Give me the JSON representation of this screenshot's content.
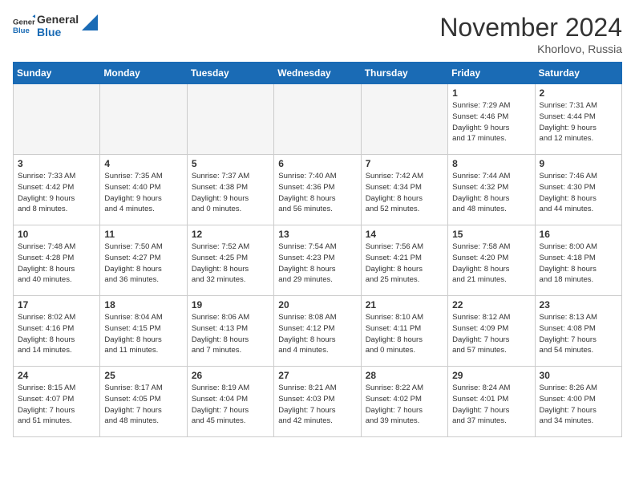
{
  "header": {
    "logo_line1": "General",
    "logo_line2": "Blue",
    "month": "November 2024",
    "location": "Khorlovo, Russia"
  },
  "weekdays": [
    "Sunday",
    "Monday",
    "Tuesday",
    "Wednesday",
    "Thursday",
    "Friday",
    "Saturday"
  ],
  "weeks": [
    [
      {
        "day": "",
        "info": "",
        "empty": true
      },
      {
        "day": "",
        "info": "",
        "empty": true
      },
      {
        "day": "",
        "info": "",
        "empty": true
      },
      {
        "day": "",
        "info": "",
        "empty": true
      },
      {
        "day": "",
        "info": "",
        "empty": true
      },
      {
        "day": "1",
        "info": "Sunrise: 7:29 AM\nSunset: 4:46 PM\nDaylight: 9 hours\nand 17 minutes."
      },
      {
        "day": "2",
        "info": "Sunrise: 7:31 AM\nSunset: 4:44 PM\nDaylight: 9 hours\nand 12 minutes."
      }
    ],
    [
      {
        "day": "3",
        "info": "Sunrise: 7:33 AM\nSunset: 4:42 PM\nDaylight: 9 hours\nand 8 minutes."
      },
      {
        "day": "4",
        "info": "Sunrise: 7:35 AM\nSunset: 4:40 PM\nDaylight: 9 hours\nand 4 minutes."
      },
      {
        "day": "5",
        "info": "Sunrise: 7:37 AM\nSunset: 4:38 PM\nDaylight: 9 hours\nand 0 minutes."
      },
      {
        "day": "6",
        "info": "Sunrise: 7:40 AM\nSunset: 4:36 PM\nDaylight: 8 hours\nand 56 minutes."
      },
      {
        "day": "7",
        "info": "Sunrise: 7:42 AM\nSunset: 4:34 PM\nDaylight: 8 hours\nand 52 minutes."
      },
      {
        "day": "8",
        "info": "Sunrise: 7:44 AM\nSunset: 4:32 PM\nDaylight: 8 hours\nand 48 minutes."
      },
      {
        "day": "9",
        "info": "Sunrise: 7:46 AM\nSunset: 4:30 PM\nDaylight: 8 hours\nand 44 minutes."
      }
    ],
    [
      {
        "day": "10",
        "info": "Sunrise: 7:48 AM\nSunset: 4:28 PM\nDaylight: 8 hours\nand 40 minutes."
      },
      {
        "day": "11",
        "info": "Sunrise: 7:50 AM\nSunset: 4:27 PM\nDaylight: 8 hours\nand 36 minutes."
      },
      {
        "day": "12",
        "info": "Sunrise: 7:52 AM\nSunset: 4:25 PM\nDaylight: 8 hours\nand 32 minutes."
      },
      {
        "day": "13",
        "info": "Sunrise: 7:54 AM\nSunset: 4:23 PM\nDaylight: 8 hours\nand 29 minutes."
      },
      {
        "day": "14",
        "info": "Sunrise: 7:56 AM\nSunset: 4:21 PM\nDaylight: 8 hours\nand 25 minutes."
      },
      {
        "day": "15",
        "info": "Sunrise: 7:58 AM\nSunset: 4:20 PM\nDaylight: 8 hours\nand 21 minutes."
      },
      {
        "day": "16",
        "info": "Sunrise: 8:00 AM\nSunset: 4:18 PM\nDaylight: 8 hours\nand 18 minutes."
      }
    ],
    [
      {
        "day": "17",
        "info": "Sunrise: 8:02 AM\nSunset: 4:16 PM\nDaylight: 8 hours\nand 14 minutes."
      },
      {
        "day": "18",
        "info": "Sunrise: 8:04 AM\nSunset: 4:15 PM\nDaylight: 8 hours\nand 11 minutes."
      },
      {
        "day": "19",
        "info": "Sunrise: 8:06 AM\nSunset: 4:13 PM\nDaylight: 8 hours\nand 7 minutes."
      },
      {
        "day": "20",
        "info": "Sunrise: 8:08 AM\nSunset: 4:12 PM\nDaylight: 8 hours\nand 4 minutes."
      },
      {
        "day": "21",
        "info": "Sunrise: 8:10 AM\nSunset: 4:11 PM\nDaylight: 8 hours\nand 0 minutes."
      },
      {
        "day": "22",
        "info": "Sunrise: 8:12 AM\nSunset: 4:09 PM\nDaylight: 7 hours\nand 57 minutes."
      },
      {
        "day": "23",
        "info": "Sunrise: 8:13 AM\nSunset: 4:08 PM\nDaylight: 7 hours\nand 54 minutes."
      }
    ],
    [
      {
        "day": "24",
        "info": "Sunrise: 8:15 AM\nSunset: 4:07 PM\nDaylight: 7 hours\nand 51 minutes."
      },
      {
        "day": "25",
        "info": "Sunrise: 8:17 AM\nSunset: 4:05 PM\nDaylight: 7 hours\nand 48 minutes."
      },
      {
        "day": "26",
        "info": "Sunrise: 8:19 AM\nSunset: 4:04 PM\nDaylight: 7 hours\nand 45 minutes."
      },
      {
        "day": "27",
        "info": "Sunrise: 8:21 AM\nSunset: 4:03 PM\nDaylight: 7 hours\nand 42 minutes."
      },
      {
        "day": "28",
        "info": "Sunrise: 8:22 AM\nSunset: 4:02 PM\nDaylight: 7 hours\nand 39 minutes."
      },
      {
        "day": "29",
        "info": "Sunrise: 8:24 AM\nSunset: 4:01 PM\nDaylight: 7 hours\nand 37 minutes."
      },
      {
        "day": "30",
        "info": "Sunrise: 8:26 AM\nSunset: 4:00 PM\nDaylight: 7 hours\nand 34 minutes."
      }
    ]
  ]
}
